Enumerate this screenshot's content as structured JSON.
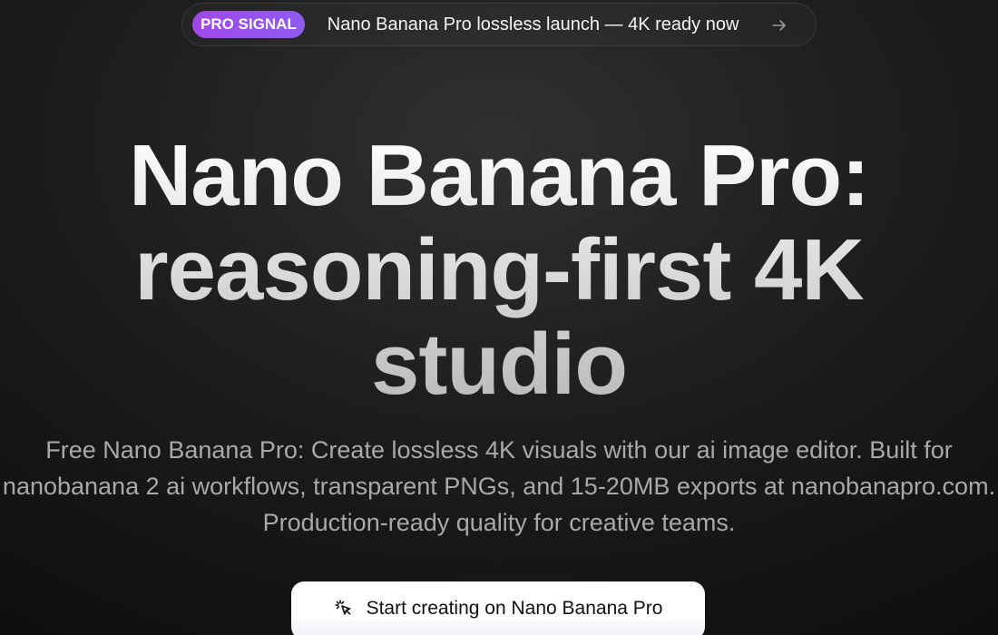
{
  "announcement": {
    "badge": "PRO SIGNAL",
    "text": "Nano Banana Pro lossless launch — 4K ready now",
    "icon": "arrow-right-icon"
  },
  "hero": {
    "title_lines": [
      "Nano Banana Pro:",
      "reasoning-first 4K",
      "studio"
    ],
    "description_lines": [
      "Free Nano Banana Pro: Create lossless 4K visuals with our ai image editor. Built for",
      "nanobanana 2 ai workflows, transparent PNGs, and 15-20MB exports at nanobanapro.com.",
      "Production-ready quality for creative teams."
    ]
  },
  "cta": {
    "label": "Start creating on Nano Banana Pro",
    "icon": "cursor-click-icon"
  },
  "colors": {
    "badge_bg": "#9b4fea",
    "background": "#1c1c1c",
    "cta_bg": "#ffffff"
  }
}
